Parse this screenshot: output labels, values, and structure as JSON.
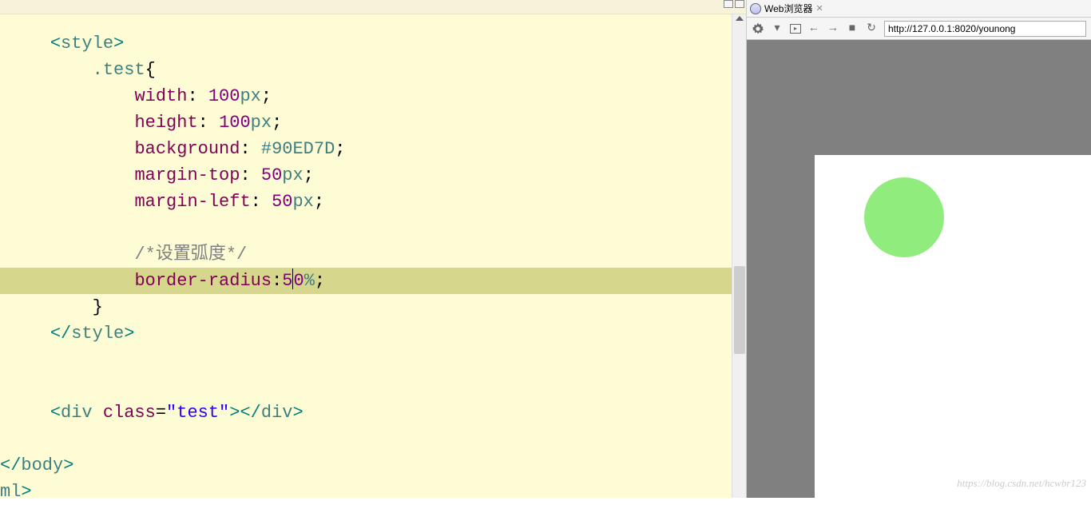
{
  "editor": {
    "line1": {
      "open": "<",
      "tag": "style",
      "close": ">"
    },
    "line2": {
      "selector": ".test",
      "brace": "{"
    },
    "line3": {
      "prop": "width",
      "colon": ":",
      "num": "100",
      "unit": "px",
      "semi": ";"
    },
    "line4": {
      "prop": "height",
      "colon": ":",
      "num": "100",
      "unit": "px",
      "semi": ";"
    },
    "line5": {
      "prop": "background",
      "colon": ":",
      "val": "#90ED7D",
      "semi": ";"
    },
    "line6": {
      "prop": "margin-top",
      "colon": ":",
      "num": "50",
      "unit": "px",
      "semi": ";"
    },
    "line7": {
      "prop": "margin-left",
      "colon": ":",
      "num": "50",
      "unit": "px",
      "semi": ";"
    },
    "line8": {
      "comment": "/*设置弧度*/"
    },
    "line9": {
      "prop": "border-radius",
      "colon": ":",
      "num1": "5",
      "num2": "0",
      "unit": "%",
      "semi": ";"
    },
    "line10": {
      "brace": "}"
    },
    "line11": {
      "open": "</",
      "tag": "style",
      "close": ">"
    },
    "line12": {
      "open": "<",
      "tag": "div",
      "attr": "class",
      "eq": "=",
      "val": "\"test\"",
      "close": ">",
      "open2": "</",
      "tag2": "div",
      "close2": ">"
    },
    "line13": {
      "open": "</",
      "tag": "body",
      "close": ">"
    },
    "line14": {
      "tag": "ml",
      "close": ">"
    }
  },
  "browser": {
    "tab_title": "Web浏览器",
    "tab_close": "✕",
    "url": "http://127.0.0.1:8020/younong",
    "nav": {
      "back": "←",
      "forward": "→",
      "stop": "■",
      "refresh": "↻"
    }
  },
  "watermark": "https://blog.csdn.net/hcwbr123"
}
